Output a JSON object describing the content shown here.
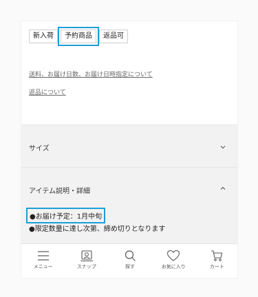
{
  "tags": [
    {
      "label": "新入荷",
      "highlighted": false
    },
    {
      "label": "予約商品",
      "highlighted": true
    },
    {
      "label": "返品可",
      "highlighted": false
    }
  ],
  "links": {
    "shipping": "送料、お届け日数、お届け日時指定について",
    "returns": "返品について"
  },
  "sections": {
    "size": {
      "title": "サイズ",
      "state": "collapsed"
    },
    "item_description": {
      "title": "アイテム説明・詳細",
      "state": "expanded"
    }
  },
  "description_lines": [
    "●お届け予定：1月中旬",
    "●限定数量に達し次第、締め切りとなります"
  ],
  "tabbar": [
    {
      "label": "メニュー",
      "icon": "menu-icon"
    },
    {
      "label": "スナップ",
      "icon": "snap-icon"
    },
    {
      "label": "探す",
      "icon": "search-icon"
    },
    {
      "label": "お気に入り",
      "icon": "heart-icon"
    },
    {
      "label": "カート",
      "icon": "cart-icon"
    }
  ],
  "colors": {
    "highlight": "#1a9fd6",
    "section_bg": "#f2f2f2"
  }
}
